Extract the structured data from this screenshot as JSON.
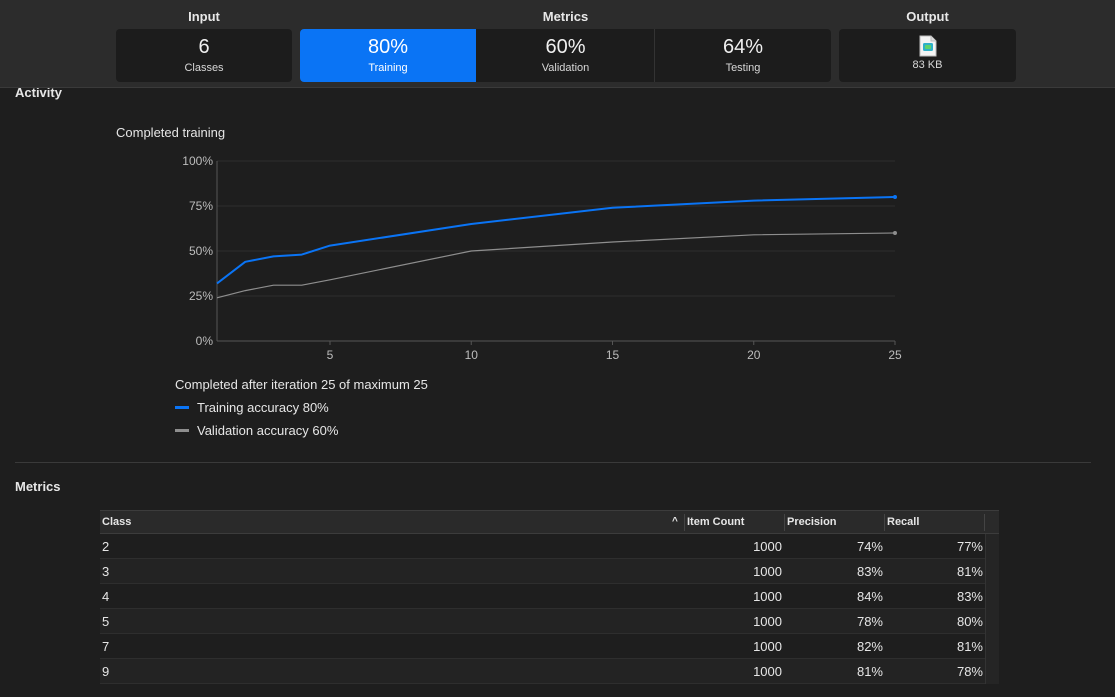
{
  "header": {
    "input_label": "Input",
    "metrics_label": "Metrics",
    "output_label": "Output",
    "classes": {
      "value": "6",
      "caption": "Classes"
    },
    "training": {
      "value": "80%",
      "caption": "Training"
    },
    "validation": {
      "value": "60%",
      "caption": "Validation"
    },
    "testing": {
      "value": "64%",
      "caption": "Testing"
    },
    "output": {
      "size": "83 KB",
      "icon": "model-file-icon"
    }
  },
  "activity": {
    "heading": "Activity",
    "chart_title": "Completed training",
    "completed_text": "Completed after iteration 25 of maximum 25",
    "legend": [
      {
        "label": "Training accuracy 80%",
        "color": "#0a74f5"
      },
      {
        "label": "Validation accuracy 60%",
        "color": "#8e8e8e"
      }
    ]
  },
  "chart_data": {
    "type": "line",
    "title": "Completed training",
    "x": [
      1,
      2,
      3,
      4,
      5,
      10,
      15,
      20,
      25
    ],
    "xlim": [
      1,
      25
    ],
    "xticks": [
      "5",
      "10",
      "15",
      "20",
      "25"
    ],
    "ylim": [
      0,
      100
    ],
    "yticks": [
      "0%",
      "25%",
      "50%",
      "75%",
      "100%"
    ],
    "grid": true,
    "series": [
      {
        "name": "Training accuracy 80%",
        "color": "#0a74f5",
        "values": [
          32,
          44,
          47,
          48,
          53,
          65,
          74,
          78,
          80
        ]
      },
      {
        "name": "Validation accuracy 60%",
        "color": "#8e8e8e",
        "values": [
          24,
          28,
          31,
          31,
          34,
          50,
          55,
          59,
          60
        ]
      }
    ]
  },
  "metrics": {
    "heading": "Metrics",
    "columns": [
      "Class",
      "Item Count",
      "Precision",
      "Recall"
    ],
    "rows": [
      {
        "class": "2",
        "count": "1000",
        "precision": "74%",
        "recall": "77%"
      },
      {
        "class": "3",
        "count": "1000",
        "precision": "83%",
        "recall": "81%"
      },
      {
        "class": "4",
        "count": "1000",
        "precision": "84%",
        "recall": "83%"
      },
      {
        "class": "5",
        "count": "1000",
        "precision": "78%",
        "recall": "80%"
      },
      {
        "class": "7",
        "count": "1000",
        "precision": "82%",
        "recall": "81%"
      },
      {
        "class": "9",
        "count": "1000",
        "precision": "81%",
        "recall": "78%"
      }
    ]
  }
}
